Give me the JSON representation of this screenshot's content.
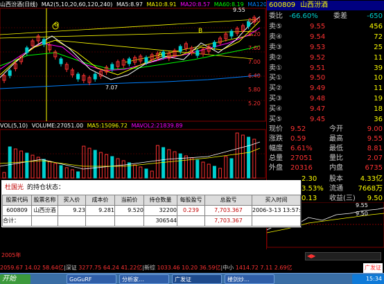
{
  "top_legend": {
    "name": "山西汾酒(日线)",
    "ma_params": "MA2(5,10,20,60,120,240)",
    "ma5": "MA5:8.97",
    "ma10": "MA10:8.91",
    "ma20": "MA20:8.57",
    "ma60": "MA60:8.19",
    "ma120": "MA120:8.0C"
  },
  "price_axis": [
    "8.80",
    "8.20",
    "7.60",
    "7.00",
    "6.40",
    "5.80",
    "5.20"
  ],
  "chart_notes": {
    "peak_label": "9.55",
    "low_label": "7.07",
    "point_o": "O",
    "point_b": "B",
    "point_a": "A"
  },
  "vol_legend": {
    "vol": "VOL(5,10)",
    "volume": "VOLUME:27051.00",
    "ma5": "MA5:15096.72",
    "mavol2": "MAVOL2:21839.89"
  },
  "right_panel": {
    "code": "600809",
    "name": "山西汾酒",
    "weibi_label": "委比",
    "weibi_val": "-66.60%",
    "weicha_label": "委差",
    "weicha_val": "-650",
    "sell": [
      {
        "label": "卖⑤",
        "price": "9.55",
        "vol": "456"
      },
      {
        "label": "卖④",
        "price": "9.54",
        "vol": "72"
      },
      {
        "label": "卖③",
        "price": "9.53",
        "vol": "25"
      },
      {
        "label": "卖②",
        "price": "9.52",
        "vol": "11"
      },
      {
        "label": "卖①",
        "price": "9.51",
        "vol": "39"
      }
    ],
    "buy": [
      {
        "label": "买①",
        "price": "9.50",
        "vol": "10"
      },
      {
        "label": "买②",
        "price": "9.49",
        "vol": "11"
      },
      {
        "label": "买③",
        "price": "9.48",
        "vol": "19"
      },
      {
        "label": "买④",
        "price": "9.47",
        "vol": "18"
      },
      {
        "label": "买⑤",
        "price": "9.45",
        "vol": "36"
      }
    ],
    "stats": [
      {
        "l1": "现价",
        "v1": "9.52",
        "l2": "今开",
        "v2": "9.00"
      },
      {
        "l1": "涨跌",
        "v1": "0.59",
        "l2": "最高",
        "v2": "9.55"
      },
      {
        "l1": "幅度",
        "v1": "6.61%",
        "l2": "最低",
        "v2": "8.81"
      },
      {
        "l1": "总量",
        "v1": "27051",
        "l2": "量比",
        "v2": "2.07"
      },
      {
        "l1": "外盘",
        "v1": "20316",
        "l2": "内盘",
        "v2": "6735"
      }
    ],
    "stats2": [
      {
        "v1": "2.30",
        "l2": "股本",
        "v2": "4.33亿"
      },
      {
        "v1": "3.53%",
        "l2": "流通",
        "v2": "7668万"
      },
      {
        "v1": "0.13",
        "l2": "收益(三)",
        "v2": "9.50"
      }
    ],
    "mini_prices": [
      "9.55",
      "9.50"
    ]
  },
  "dialog": {
    "user": "杜国光",
    "title": "的持仓状态：",
    "headers": [
      "股票代码",
      "股票名称",
      "买入价",
      "成本价",
      "当前价",
      "持仓数量",
      "每股盈亏",
      "总盈亏",
      "买入时间"
    ],
    "row": [
      "600809",
      "山西汾酒",
      "9.23",
      "9.281",
      "9.520",
      "32200",
      "0.239",
      "7,703.367",
      "2006-3-13 13:57:28"
    ],
    "total_label": "合计：",
    "total_qty": "306544",
    "total_profit": "7,703.367"
  },
  "tabs": {
    "year": "2005年"
  },
  "status_bar": {
    "sh_label": "2059.67",
    "sh_chg": "14.02",
    "sh_vol": "58.64亿",
    "sz_label": "深证",
    "sz_val": "3277.75",
    "sz_chg": "64.24",
    "sz_vol": "41.22亿",
    "xx_label": "新综",
    "xx_val": "1033.46",
    "xx_chg": "10.20",
    "xx_vol": "36.59亿",
    "zx_label": "中小",
    "zx_val": "1414.72",
    "zx_chg": "7.11",
    "zx_vol": "2.69亿",
    "right": "广发证"
  },
  "taskbar": {
    "start": "开始",
    "items": [
      "GoGuRF",
      "分析家…",
      "广发证",
      "楼剑炒…"
    ],
    "time": "15:34"
  },
  "colors": {
    "up": "#ff3232",
    "down": "#00d0d0",
    "ma5": "#ffffff",
    "ma10": "#ffff00",
    "ma20": "#ff00ff",
    "ma60": "#00ff00",
    "ma120": "#0080ff"
  }
}
